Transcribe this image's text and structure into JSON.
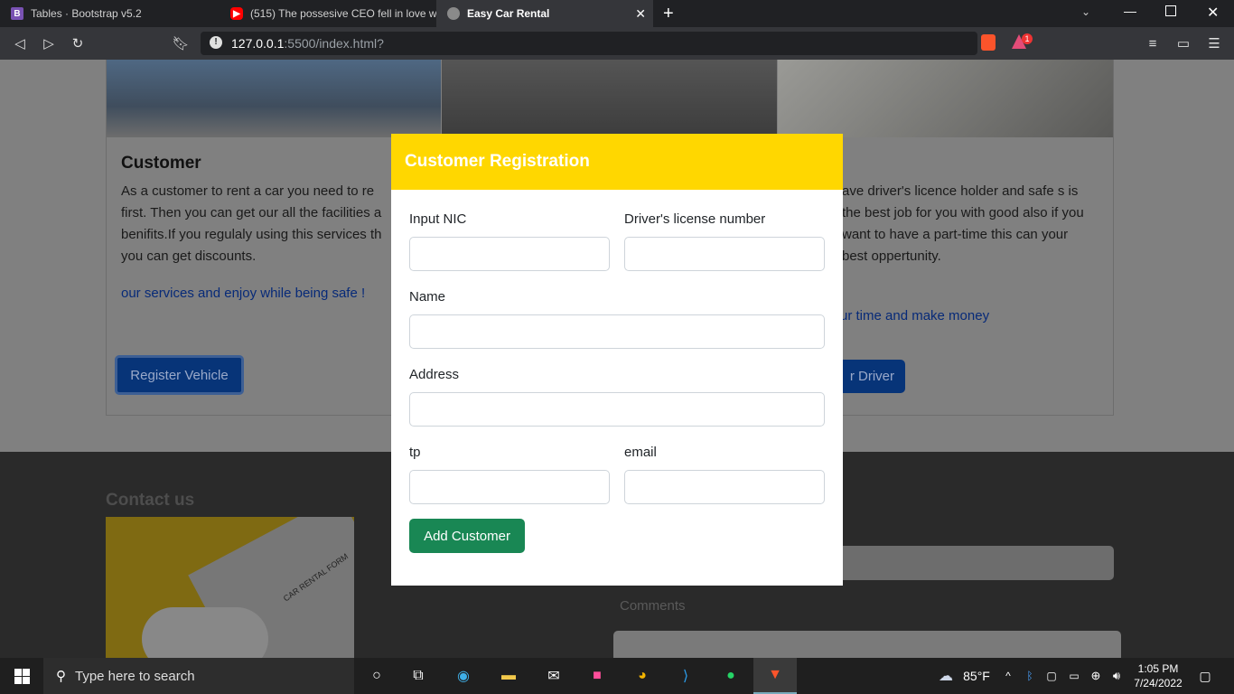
{
  "browser": {
    "tabs": [
      {
        "label": "Tables · Bootstrap v5.2",
        "icon": "bootstrap-icon"
      },
      {
        "label": "(515) The possesive CEO fell in love wi",
        "icon": "youtube-icon"
      },
      {
        "label": "Easy Car Rental",
        "icon": "globe-icon",
        "active": true
      }
    ],
    "url_host": "127.0.0.1",
    "url_rest": ":5500/index.html?",
    "brave_badge": "1"
  },
  "page": {
    "customer_card": {
      "title": "Customer",
      "text": "As a customer to rent a car you need to re first. Then you can get our all the facilities a benifits.If you regulaly using this services th you can get discounts.",
      "link": "our services and enjoy while being safe !",
      "button": "Register Vehicle"
    },
    "driver_card": {
      "text": "ave driver's licence holder and safe s is the best job for you with good also if you want to have a part-time this can your best oppertunity.",
      "link": "ur time and make money",
      "button": "r Driver"
    },
    "footer": {
      "contact_heading": "Contact us",
      "comments_label": "Comments",
      "image_text": "CAR RENTAL FORM"
    }
  },
  "modal": {
    "title": "Customer Registration",
    "fields": {
      "nic_label": "Input NIC",
      "license_label": "Driver's license number",
      "name_label": "Name",
      "address_label": "Address",
      "tp_label": "tp",
      "email_label": "email"
    },
    "submit": "Add Customer"
  },
  "taskbar": {
    "search_placeholder": "Type here to search",
    "weather": "85°F",
    "time": "1:05 PM",
    "date": "7/24/2022"
  },
  "colors": {
    "modal_header": "#ffd700",
    "submit": "#198754",
    "primary": "#0d6efd"
  }
}
